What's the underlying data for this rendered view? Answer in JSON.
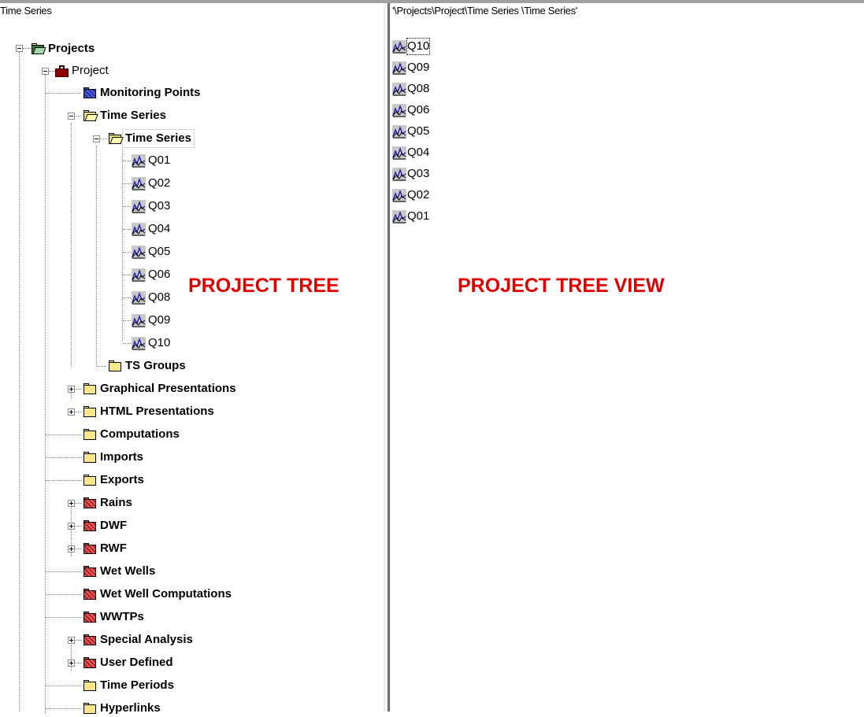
{
  "left_pane": {
    "header": "Time Series",
    "overlay_label": "PROJECT TREE"
  },
  "right_pane": {
    "path": "'\\Projects\\Project\\Time Series \\Time Series'",
    "overlay_label": "PROJECT TREE VIEW",
    "items": [
      "Q10",
      "Q09",
      "Q08",
      "Q06",
      "Q05",
      "Q04",
      "Q03",
      "Q02",
      "Q01"
    ]
  },
  "tree": {
    "root": "Projects",
    "project": "Project",
    "monitoring_points": "Monitoring Points",
    "time_series": "Time Series",
    "time_series_child": "Time Series",
    "series": [
      "Q01",
      "Q02",
      "Q03",
      "Q04",
      "Q05",
      "Q06",
      "Q08",
      "Q09",
      "Q10"
    ],
    "ts_groups": "TS Groups",
    "graphical_presentations": "Graphical Presentations",
    "html_presentations": "HTML Presentations",
    "computations": "Computations",
    "imports": "Imports",
    "exports": "Exports",
    "rains": "Rains",
    "dwf": "DWF",
    "rwf": "RWF",
    "wet_wells": "Wet Wells",
    "wet_well_computations": "Wet Well Computations",
    "wwtps": "WWTPs",
    "special_analysis": "Special Analysis",
    "user_defined": "User Defined",
    "time_periods": "Time Periods",
    "hyperlinks": "Hyperlinks"
  },
  "icons": {
    "project": "briefcase-icon",
    "folder": "folder-icon",
    "time_series": "time-series-chart-icon",
    "expand": "expand-icon",
    "collapse": "collapse-icon"
  },
  "colors": {
    "overlay_text": "#e00000",
    "folder_yellow": "#f7e68a",
    "folder_blue": "#3348c8",
    "folder_red": "#d04040",
    "folder_green": "#2e7d32",
    "project_icon": "#8b0000"
  }
}
